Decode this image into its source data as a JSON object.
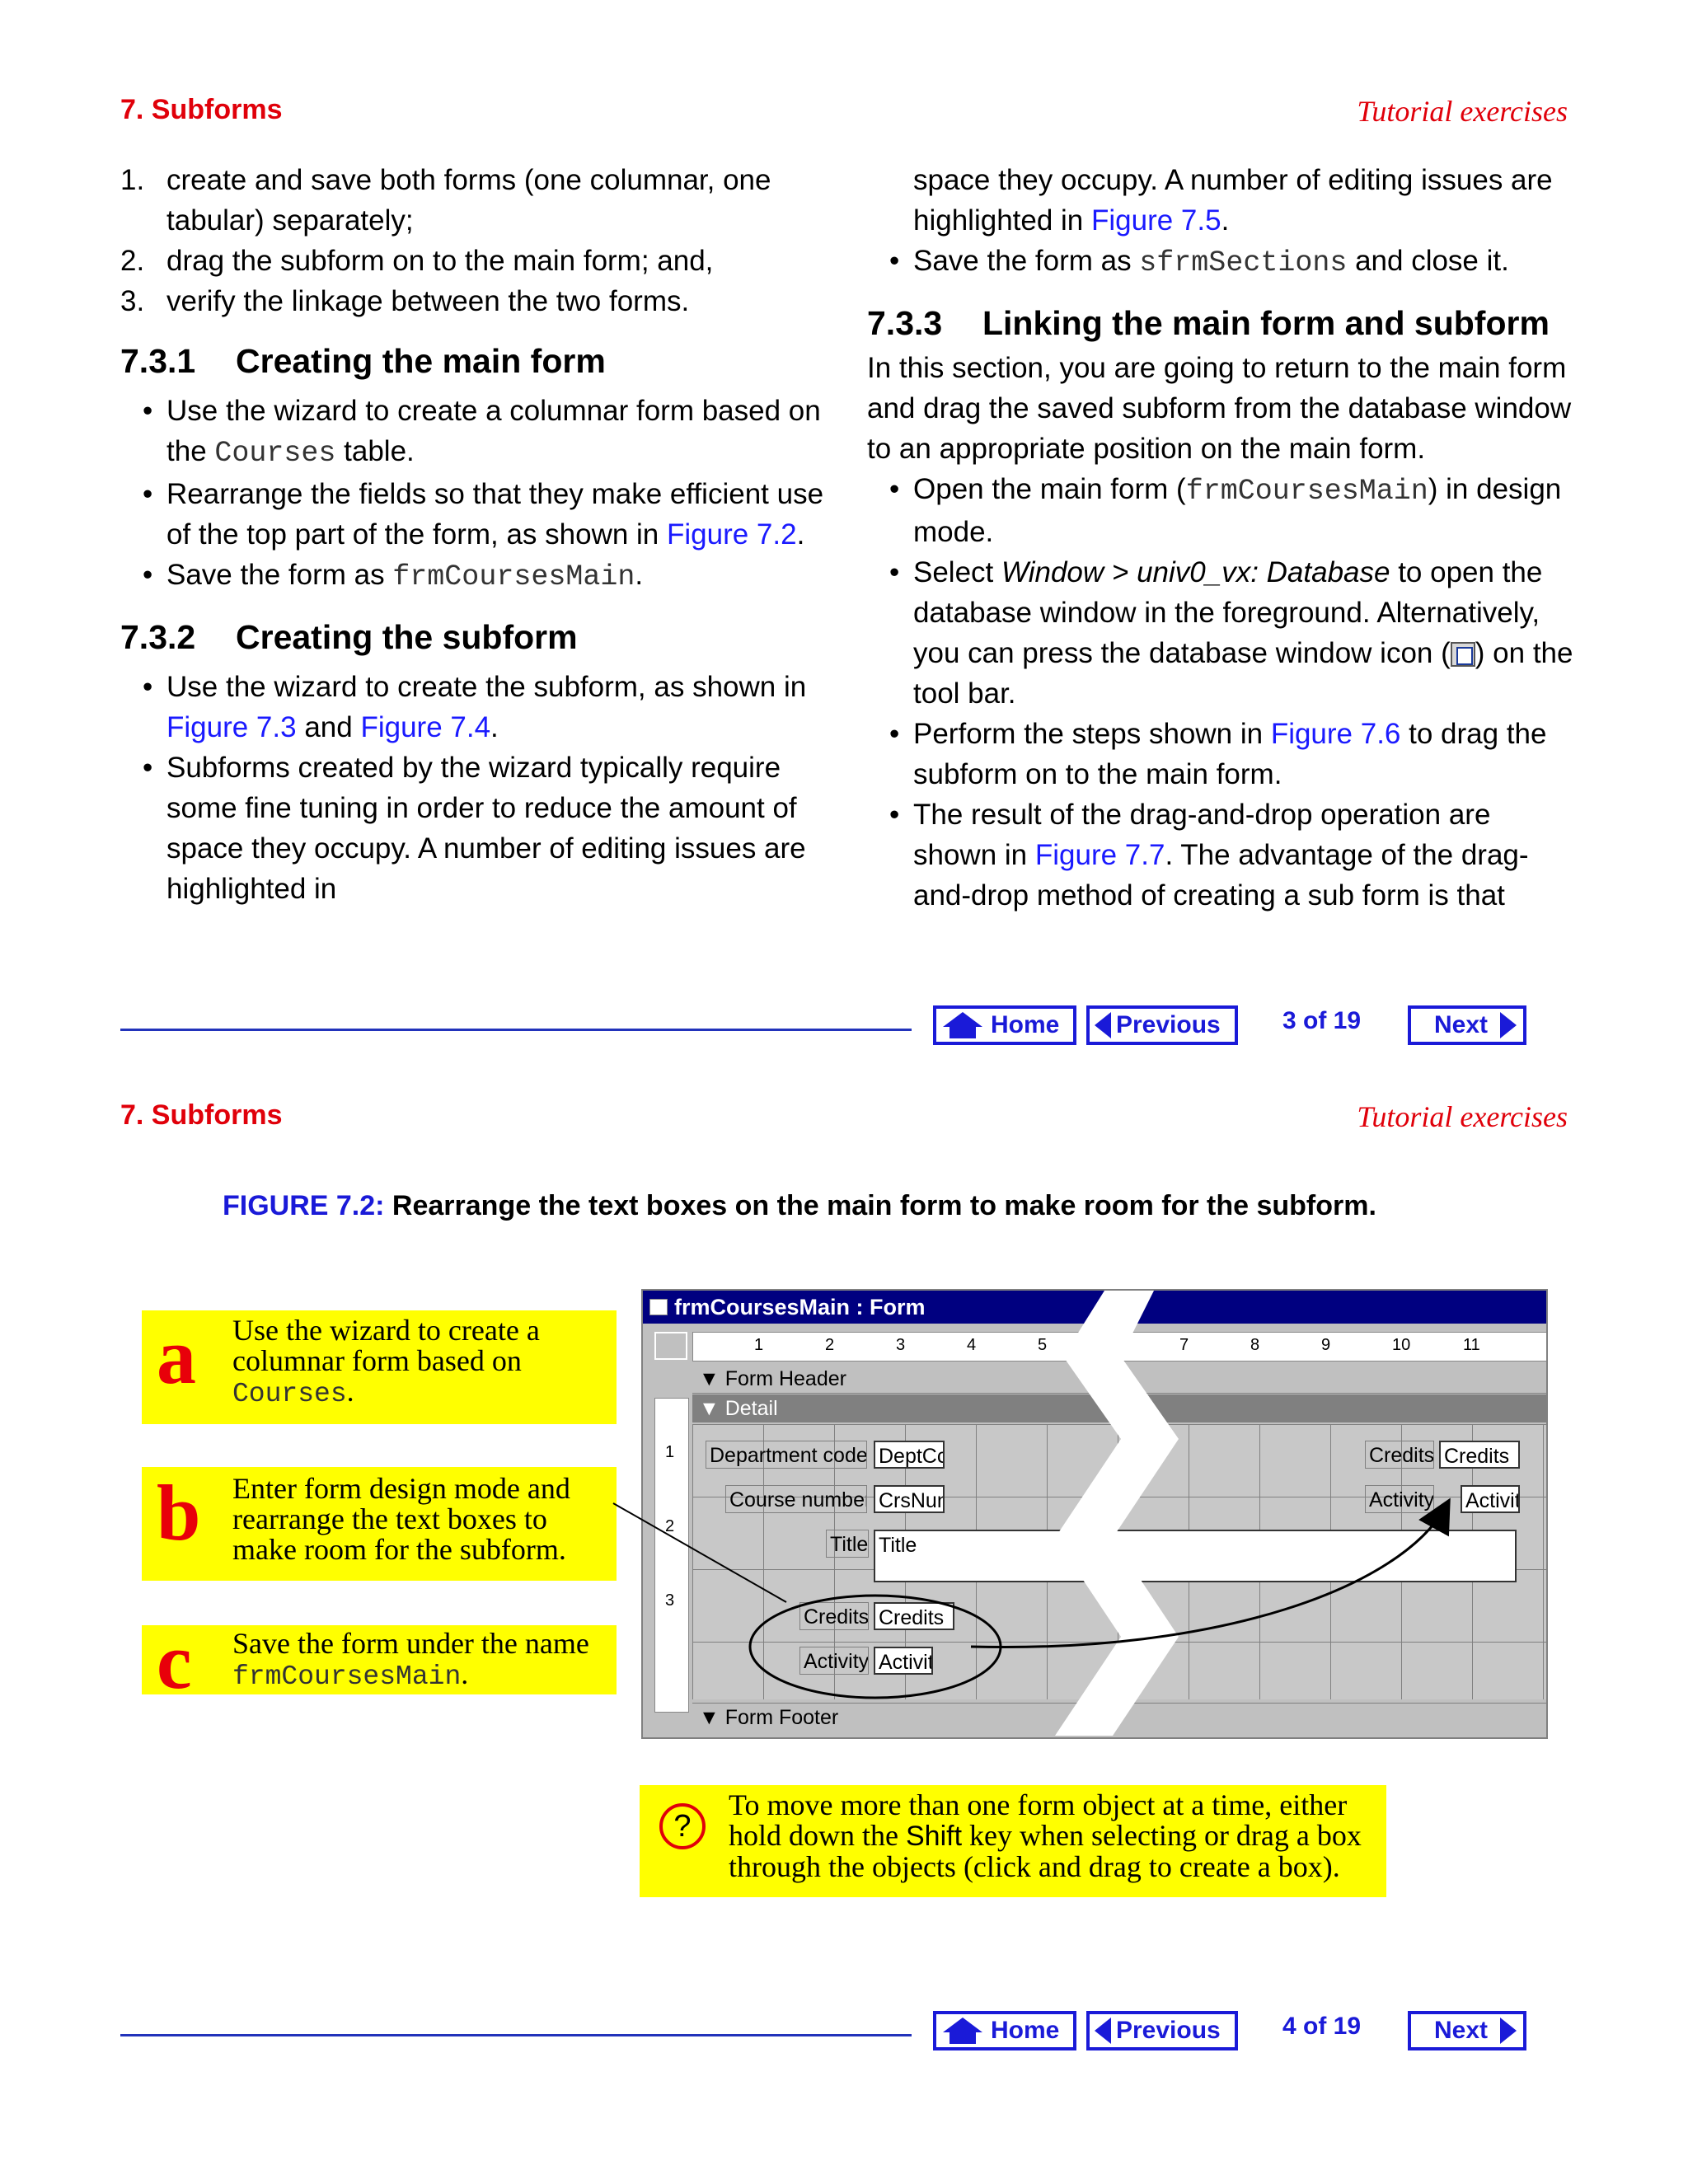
{
  "page3": {
    "header": {
      "left": "7. Subforms",
      "right": "Tutorial exercises"
    },
    "steps": [
      {
        "num": "1.",
        "text": "create and save both forms (one columnar, one tabular) separately;"
      },
      {
        "num": "2.",
        "text": "drag the subform on to the main form; and,"
      },
      {
        "num": "3.",
        "text": "verify the linkage between the two forms."
      }
    ],
    "s731": {
      "num": "7.3.1",
      "title": "Creating the main form",
      "b1": {
        "pre": "Use the wizard to create a columnar form based on the ",
        "code": "Courses",
        "post": " table."
      },
      "b2": {
        "pre": "Rearrange the fields so that they make efficient use of the top part of the form, as shown in ",
        "link": "Figure 7.2",
        "post": "."
      },
      "b3": {
        "pre": "Save the form as ",
        "code": "frmCoursesMain",
        "post": "."
      }
    },
    "s732": {
      "num": "7.3.2",
      "title": "Creating the subform",
      "b1": {
        "pre": "Use the wizard to create the subform, as shown in ",
        "link1": "Figure 7.3",
        "mid": " and ",
        "link2": "Figure 7.4",
        "post": "."
      },
      "b2": {
        "pre": "Subforms created by the wizard typically require some fine tuning in order to reduce the amount of space they occupy. A number of editing issues are highlighted in ",
        "link": "Figure 7.5",
        "post": "."
      },
      "b3": {
        "pre": "Save the form as ",
        "code": "sfrmSections",
        "post": " and close it."
      }
    },
    "s733": {
      "num": "7.3.3",
      "title": "Linking the main form and subform",
      "intro": "In this section, you are going to return to the main form and drag the saved subform from the database window to an appropriate position on the main form.",
      "b1": {
        "pre": "Open the main form (",
        "code": "frmCoursesMain",
        "post": ") in design mode."
      },
      "b2": {
        "pre": "Select ",
        "ital": "Window > univ0_vx: Database",
        "post1": " to open the database window in the foreground. Alternatively, you can press the database window icon (",
        "post2": ") on the tool bar."
      },
      "b3": {
        "pre": "Perform the steps shown in ",
        "link": "Figure 7.6",
        "post": " to drag the subform on to the main form."
      },
      "b4": {
        "pre": "The result of the drag-and-drop operation are shown in ",
        "link": "Figure 7.7",
        "post": ". The advantage of the drag-and-drop method of creating a sub form is that"
      }
    },
    "nav": {
      "home": "Home",
      "previous": "Previous",
      "page": "3 of 19",
      "next": "Next"
    }
  },
  "page4": {
    "header": {
      "left": "7. Subforms",
      "right": "Tutorial exercises"
    },
    "caption": {
      "label": "FIGURE 7.2:",
      "text": " Rearrange the text boxes on the main form to make room for the subform."
    },
    "callout_a": {
      "letter": "a",
      "pre": "Use the wizard to create a columnar form based on ",
      "code": "Courses",
      "post": "."
    },
    "callout_b": {
      "letter": "b",
      "text": "Enter form design mode and rearrange the text boxes to make room for the subform."
    },
    "callout_c": {
      "letter": "c",
      "pre": "Save the form under the name ",
      "code": "frmCoursesMain",
      "post": "."
    },
    "window": {
      "title": "frmCoursesMain : Form",
      "ruler": [
        "1",
        "2",
        "3",
        "4",
        "5",
        "7",
        "8",
        "9",
        "10",
        "11"
      ],
      "vruler": [
        "1",
        "2",
        "3"
      ],
      "form_header": "Form Header",
      "detail": "Detail",
      "form_footer": "Form Footer",
      "fields": {
        "dept_label": "Department code",
        "dept_box": "DeptCc",
        "course_label": "Course number",
        "course_box": "CrsNun",
        "title_label": "Title",
        "title_box": "Title",
        "credits_label": "Credits",
        "credits_box": "Credits",
        "activity_label": "Activity",
        "activity_box": "Activit",
        "credits_label2": "Credits",
        "credits_box2": "Credits",
        "activity_label2": "Activity",
        "activity_box2": "Activit"
      }
    },
    "tip": {
      "pre": "To move more than one form object at a time, either hold down the ",
      "key": "Shift",
      "post": " key when selecting or drag a box through the objects (click and drag to create a box)."
    },
    "nav": {
      "home": "Home",
      "previous": "Previous",
      "page": "4 of 19",
      "next": "Next"
    }
  },
  "colors": {
    "heading_red": "#e0000a",
    "link_blue": "#1a1aff",
    "nav_blue": "#1a1ad8",
    "callout_yellow": "#ffff00",
    "title_bar_navy": "#000080"
  }
}
